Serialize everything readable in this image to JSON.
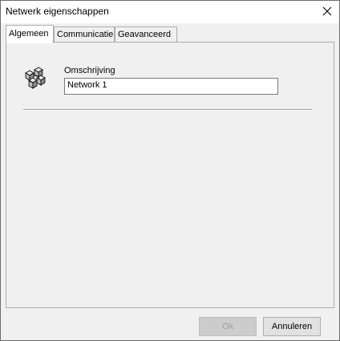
{
  "window": {
    "title": "Netwerk eigenschappen"
  },
  "tabs": [
    {
      "label": "Algemeen",
      "active": true
    },
    {
      "label": "Communicatie",
      "active": false
    },
    {
      "label": "Geavanceerd",
      "active": false
    }
  ],
  "general": {
    "icon": "network-icon",
    "description_label": "Omschrijving",
    "description_value": "Network 1"
  },
  "buttons": {
    "ok_label": "Ok",
    "ok_enabled": false,
    "cancel_label": "Annuleren"
  },
  "colors": {
    "dialog_background": "#f0f0f0",
    "title_background": "#ffffff",
    "disabled_text": "#a0a0a0"
  }
}
